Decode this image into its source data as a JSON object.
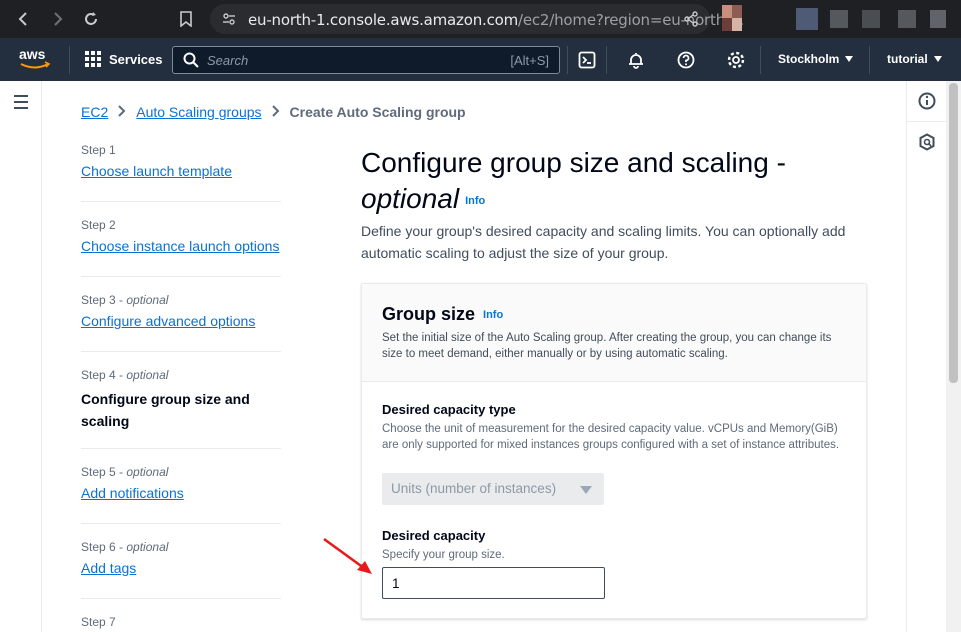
{
  "browser": {
    "url_main": "eu-north-1.console.aws.amazon.com",
    "url_rest": "/ec2/home?region=eu-north-..."
  },
  "aws_nav": {
    "services_label": "Services",
    "search_placeholder": "Search",
    "search_hint": "[Alt+S]",
    "region_label": "Stockholm",
    "account_label": "tutorial"
  },
  "breadcrumb": {
    "items": [
      "EC2",
      "Auto Scaling groups"
    ],
    "current": "Create Auto Scaling group"
  },
  "steps": [
    {
      "num": "Step 1",
      "optional": "",
      "label": "Choose launch template",
      "current": false
    },
    {
      "num": "Step 2",
      "optional": "",
      "label": "Choose instance launch options",
      "current": false
    },
    {
      "num": "Step 3",
      "optional": "optional",
      "label": "Configure advanced options",
      "current": false
    },
    {
      "num": "Step 4",
      "optional": "optional",
      "label": "Configure group size and scaling",
      "current": true
    },
    {
      "num": "Step 5",
      "optional": "optional",
      "label": "Add notifications",
      "current": false
    },
    {
      "num": "Step 6",
      "optional": "optional",
      "label": "Add tags",
      "current": false
    },
    {
      "num": "Step 7",
      "optional": "",
      "label": "",
      "current": false
    }
  ],
  "main": {
    "title": "Configure group size and scaling -",
    "title_optional": "optional",
    "info_label": "Info",
    "description": "Define your group's desired capacity and scaling limits. You can optionally add automatic scaling to adjust the size of your group."
  },
  "group_size": {
    "title": "Group size",
    "info_label": "Info",
    "description": "Set the initial size of the Auto Scaling group. After creating the group, you can change its size to meet demand, either manually or by using automatic scaling.",
    "capacity_type_label": "Desired capacity type",
    "capacity_type_desc": "Choose the unit of measurement for the desired capacity value. vCPUs and Memory(GiB) are only supported for mixed instances groups configured with a set of instance attributes.",
    "capacity_type_value": "Units (number of instances)",
    "desired_capacity_label": "Desired capacity",
    "desired_capacity_desc": "Specify your group size.",
    "desired_capacity_value": "1"
  },
  "colors": {
    "aws_nav_bg": "#232f3e",
    "link": "#0972d3",
    "annotation_arrow": "#e8191b"
  }
}
